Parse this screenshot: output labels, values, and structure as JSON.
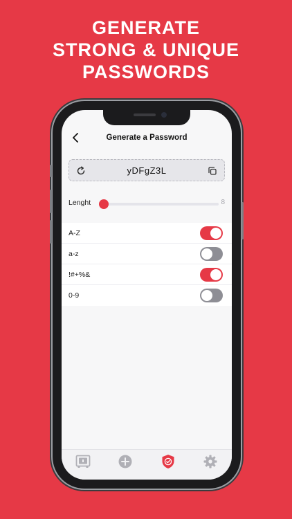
{
  "headline": {
    "line1": "GENERATE",
    "line2": "STRONG & UNIQUE",
    "line3": "PASSWORDS"
  },
  "navbar": {
    "title": "Generate a Password",
    "back_icon": "chevron-left-icon"
  },
  "password": {
    "value": "yDFgZ3L",
    "refresh_icon": "refresh-icon",
    "copy_icon": "copy-icon"
  },
  "length": {
    "label": "Lenght",
    "value": "8",
    "slider_fraction": 0
  },
  "options": [
    {
      "label": "A-Z",
      "enabled": true
    },
    {
      "label": "a-z",
      "enabled": false
    },
    {
      "label": "!#+%&",
      "enabled": true
    },
    {
      "label": "0-9",
      "enabled": false
    }
  ],
  "tabbar": {
    "items": [
      {
        "icon": "vault-icon",
        "active": false
      },
      {
        "icon": "plus-circle-icon",
        "active": false
      },
      {
        "icon": "shield-check-icon",
        "active": true
      },
      {
        "icon": "gear-icon",
        "active": false
      }
    ]
  },
  "colors": {
    "accent": "#e63946",
    "toggle_off": "#8e8e95",
    "tab_inactive": "#b0b0b6"
  }
}
